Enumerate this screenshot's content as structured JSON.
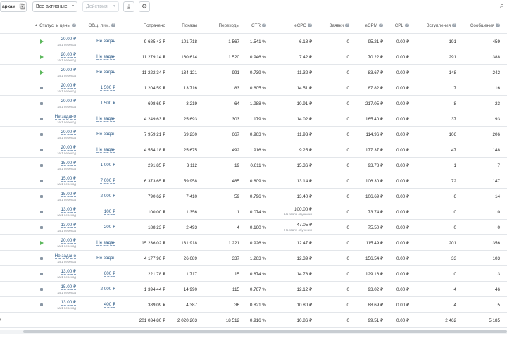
{
  "toolbar": {
    "title": "аркам",
    "filter_label": "Все активные",
    "actions_label": "Действия"
  },
  "columns": {
    "status": "Статус",
    "bid": "ь цены",
    "limit": "Общ. лим.",
    "spent": "Потрачено",
    "impressions": "Показы",
    "clicks": "Переходы",
    "ctr": "CTR",
    "ecpc": "eCPC",
    "leads": "Заявки",
    "ecpm": "eCPM",
    "cpl": "CPL",
    "joins": "Вступления",
    "messages": "Сообщения"
  },
  "bid_sub_label": "за 1 переход",
  "ecpc_note": "На этапе обучения",
  "rows": [
    {
      "status": "active",
      "bid": "20.00 ₽",
      "limit": "Не задан",
      "spent": "9 685.43 ₽",
      "impressions": "101 718",
      "clicks": "1 567",
      "ctr": "1.541 %",
      "ecpc": "6.18 ₽",
      "leads": "0",
      "ecpm": "95.21 ₽",
      "cpl": "0.00 ₽",
      "joins": "191",
      "messages": "459"
    },
    {
      "status": "active",
      "bid": "20.00 ₽",
      "limit": "Не задан",
      "spent": "11 279.14 ₽",
      "impressions": "160 614",
      "clicks": "1 520",
      "ctr": "0.946 %",
      "ecpc": "7.42 ₽",
      "leads": "0",
      "ecpm": "70.22 ₽",
      "cpl": "0.00 ₽",
      "joins": "291",
      "messages": "388"
    },
    {
      "status": "active",
      "bid": "20.00 ₽",
      "limit": "Не задан",
      "spent": "11 222.34 ₽",
      "impressions": "134 121",
      "clicks": "991",
      "ctr": "0.739 %",
      "ecpc": "11.32 ₽",
      "leads": "0",
      "ecpm": "83.67 ₽",
      "cpl": "0.00 ₽",
      "joins": "148",
      "messages": "242"
    },
    {
      "status": "paused",
      "bid": "20.00 ₽",
      "limit": "1 500 ₽",
      "spent": "1 204.59 ₽",
      "impressions": "13 716",
      "clicks": "83",
      "ctr": "0.605 %",
      "ecpc": "14.51 ₽",
      "leads": "0",
      "ecpm": "87.82 ₽",
      "cpl": "0.00 ₽",
      "joins": "7",
      "messages": "16"
    },
    {
      "status": "paused",
      "bid": "20.00 ₽",
      "limit": "1 500 ₽",
      "spent": "698.69 ₽",
      "impressions": "3 219",
      "clicks": "64",
      "ctr": "1.988 %",
      "ecpc": "10.91 ₽",
      "leads": "0",
      "ecpm": "217.05 ₽",
      "cpl": "0.00 ₽",
      "joins": "8",
      "messages": "23"
    },
    {
      "status": "paused",
      "bid": "Не задано",
      "limit": "Не задан",
      "spent": "4 249.63 ₽",
      "impressions": "25 693",
      "clicks": "303",
      "ctr": "1.179 %",
      "ecpc": "14.02 ₽",
      "leads": "0",
      "ecpm": "165.40 ₽",
      "cpl": "0.00 ₽",
      "joins": "37",
      "messages": "93"
    },
    {
      "status": "paused",
      "bid": "20.00 ₽",
      "limit": "Не задан",
      "spent": "7 959.21 ₽",
      "impressions": "69 230",
      "clicks": "667",
      "ctr": "0.963 %",
      "ecpc": "11.93 ₽",
      "leads": "0",
      "ecpm": "114.96 ₽",
      "cpl": "0.00 ₽",
      "joins": "106",
      "messages": "206"
    },
    {
      "status": "paused",
      "bid": "20.00 ₽",
      "limit": "Не задан",
      "spent": "4 554.18 ₽",
      "impressions": "25 675",
      "clicks": "492",
      "ctr": "1.916 %",
      "ecpc": "9.25 ₽",
      "leads": "0",
      "ecpm": "177.37 ₽",
      "cpl": "0.00 ₽",
      "joins": "47",
      "messages": "148"
    },
    {
      "status": "paused",
      "bid": "15.00 ₽",
      "limit": "1 000 ₽",
      "spent": "291.85 ₽",
      "impressions": "3 112",
      "clicks": "19",
      "ctr": "0.611 %",
      "ecpc": "15.36 ₽",
      "leads": "0",
      "ecpm": "93.78 ₽",
      "cpl": "0.00 ₽",
      "joins": "1",
      "messages": "7"
    },
    {
      "status": "paused",
      "bid": "15.00 ₽",
      "limit": "7 000 ₽",
      "spent": "6 373.65 ₽",
      "impressions": "59 958",
      "clicks": "485",
      "ctr": "0.809 %",
      "ecpc": "13.14 ₽",
      "leads": "0",
      "ecpm": "106.30 ₽",
      "cpl": "0.00 ₽",
      "joins": "72",
      "messages": "147"
    },
    {
      "status": "paused",
      "bid": "15.00 ₽",
      "limit": "2 000 ₽",
      "spent": "790.62 ₽",
      "impressions": "7 410",
      "clicks": "59",
      "ctr": "0.796 %",
      "ecpc": "13.40 ₽",
      "leads": "0",
      "ecpm": "106.69 ₽",
      "cpl": "0.00 ₽",
      "joins": "6",
      "messages": "14"
    },
    {
      "status": "paused",
      "bid": "13.00 ₽",
      "limit": "100 ₽",
      "spent": "100.00 ₽",
      "impressions": "1 356",
      "clicks": "1",
      "ctr": "0.074 %",
      "ecpc": "100.00 ₽",
      "ecpc_learning": true,
      "leads": "0",
      "ecpm": "73.74 ₽",
      "cpl": "0.00 ₽",
      "joins": "0",
      "messages": "0"
    },
    {
      "status": "paused",
      "bid": "13.00 ₽",
      "limit": "200 ₽",
      "spent": "188.23 ₽",
      "impressions": "2 493",
      "clicks": "4",
      "ctr": "0.160 %",
      "ecpc": "47.05 ₽",
      "ecpc_learning": true,
      "leads": "0",
      "ecpm": "75.50 ₽",
      "cpl": "0.00 ₽",
      "joins": "0",
      "messages": "0"
    },
    {
      "status": "active",
      "bid": "20.00 ₽",
      "limit": "Не задан",
      "spent": "15 236.02 ₽",
      "impressions": "131 918",
      "clicks": "1 221",
      "ctr": "0.926 %",
      "ecpc": "12.47 ₽",
      "leads": "0",
      "ecpm": "115.49 ₽",
      "cpl": "0.00 ₽",
      "joins": "201",
      "messages": "356"
    },
    {
      "status": "paused",
      "bid": "Не задано",
      "limit": "Не задан",
      "spent": "4 177.96 ₽",
      "impressions": "26 689",
      "clicks": "337",
      "ctr": "1.263 %",
      "ecpc": "12.39 ₽",
      "leads": "0",
      "ecpm": "156.54 ₽",
      "cpl": "0.00 ₽",
      "joins": "33",
      "messages": "103"
    },
    {
      "status": "paused",
      "bid": "13.00 ₽",
      "limit": "600 ₽",
      "spent": "221.78 ₽",
      "impressions": "1 717",
      "clicks": "15",
      "ctr": "0.874 %",
      "ecpc": "14.78 ₽",
      "leads": "0",
      "ecpm": "129.16 ₽",
      "cpl": "0.00 ₽",
      "joins": "0",
      "messages": "3"
    },
    {
      "status": "paused",
      "bid": "15.00 ₽",
      "limit": "2 000 ₽",
      "spent": "1 394.44 ₽",
      "impressions": "14 990",
      "clicks": "115",
      "ctr": "0.767 %",
      "ecpc": "12.12 ₽",
      "leads": "0",
      "ecpm": "93.02 ₽",
      "cpl": "0.00 ₽",
      "joins": "4",
      "messages": "46"
    },
    {
      "status": "paused",
      "bid": "13.00 ₽",
      "limit": "400 ₽",
      "spent": "389.09 ₽",
      "impressions": "4 387",
      "clicks": "36",
      "ctr": "0.821 %",
      "ecpc": "10.80 ₽",
      "leads": "0",
      "ecpm": "88.69 ₽",
      "cpl": "0.00 ₽",
      "joins": "4",
      "messages": "5"
    }
  ],
  "totals": {
    "label": "\\",
    "spent": "201 034.80 ₽",
    "impressions": "2 020 203",
    "clicks": "18 512",
    "ctr": "0.916 %",
    "ecpc": "10.86 ₽",
    "leads": "0",
    "ecpm": "99.51 ₽",
    "cpl": "0.00 ₽",
    "joins": "2 462",
    "messages": "5 185"
  }
}
